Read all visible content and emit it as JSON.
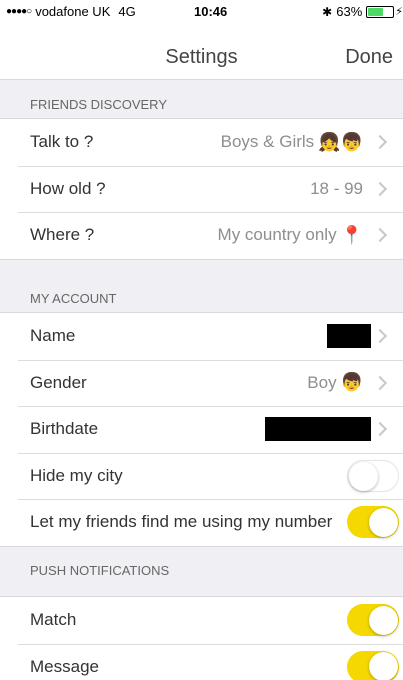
{
  "status": {
    "signal": "●●●●○",
    "carrier": "vodafone UK",
    "network": "4G",
    "time": "10:46",
    "bluetooth": "✱",
    "battery_pct": "63%",
    "battery_level": 0.63
  },
  "nav": {
    "title": "Settings",
    "done": "Done"
  },
  "friends_discovery": {
    "header": "FRIENDS DISCOVERY",
    "talk_to": {
      "label": "Talk to ?",
      "value": "Boys & Girls",
      "emoji": "👧👦"
    },
    "how_old": {
      "label": "How old ?",
      "value": "18 - 99"
    },
    "where": {
      "label": "Where ?",
      "value": "My country only",
      "emoji": "📍"
    }
  },
  "my_account": {
    "header": "MY ACCOUNT",
    "name": {
      "label": "Name"
    },
    "gender": {
      "label": "Gender",
      "value": "Boy",
      "emoji": "👦"
    },
    "birthdate": {
      "label": "Birthdate"
    },
    "hide_city": {
      "label": "Hide my city",
      "on": false
    },
    "find_by_number": {
      "label": "Let my friends find me using my number",
      "on": true
    }
  },
  "push_notifications": {
    "header": "PUSH NOTIFICATIONS",
    "match": {
      "label": "Match",
      "on": true
    },
    "message": {
      "label": "Message",
      "on": true
    }
  },
  "colors": {
    "accent_toggle": "#f5d800",
    "chevron": "#c7c7cc",
    "value_text": "#8e8e93"
  }
}
